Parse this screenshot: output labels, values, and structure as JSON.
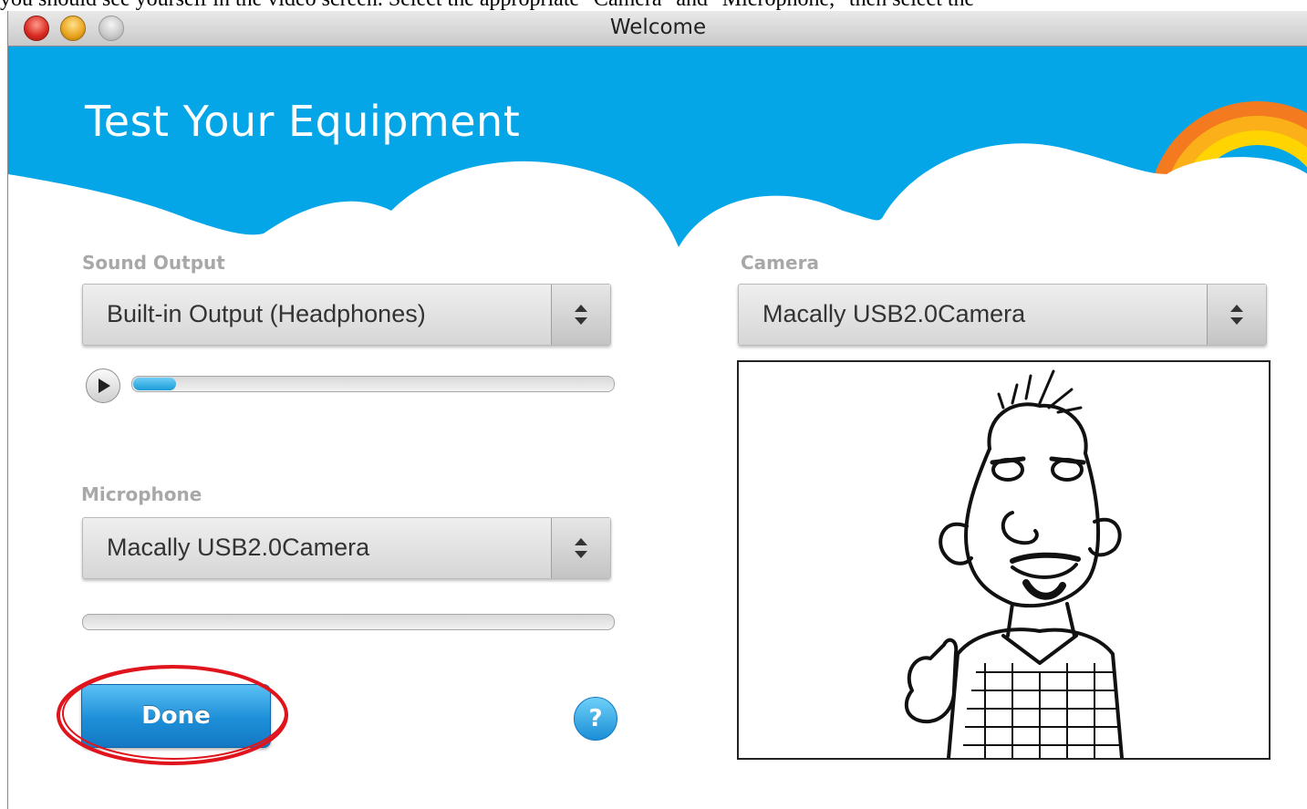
{
  "doc_caption": "you should see yourself in the video screen. Select the appropriate \"Camera\" and \"Microphone,\" then select the",
  "window": {
    "title": "Welcome"
  },
  "header": {
    "title": "Test Your Equipment"
  },
  "sound_output": {
    "label": "Sound Output",
    "selected": "Built-in Output (Headphones)",
    "progress": 0.09
  },
  "microphone": {
    "label": "Microphone",
    "selected": "Macally USB2.0Camera",
    "level": 0
  },
  "camera": {
    "label": "Camera",
    "selected": "Macally USB2.0Camera"
  },
  "buttons": {
    "done": "Done",
    "help": "?"
  },
  "colors": {
    "sky": "#04a6e8",
    "accent": "#1d8fd8",
    "annotation": "#e0141c"
  }
}
